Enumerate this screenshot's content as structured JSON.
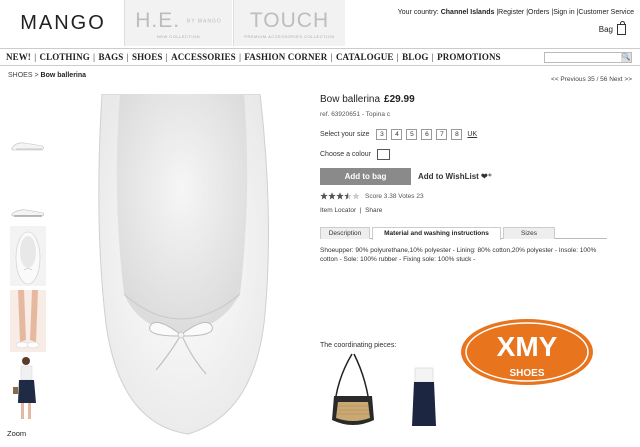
{
  "header": {
    "logo": "MANGO",
    "he_tab": {
      "title": "H.E.",
      "by": "BY MANGO",
      "sub": "NEW COLLECTION"
    },
    "touch_tab": {
      "title": "TOUCH",
      "sub": "PREMIUM ACCESSORIES COLLECTION"
    },
    "country_label": "Your country:",
    "country_value": "Channel Islands",
    "links": [
      "Register",
      "Orders",
      "Sign in",
      "Customer Service"
    ],
    "bag_label": "Bag"
  },
  "nav": {
    "items": [
      "NEW!",
      "CLOTHING",
      "BAGS",
      "SHOES",
      "ACCESSORIES",
      "FASHION CORNER",
      "CATALOGUE",
      "BLOG",
      "PROMOTIONS"
    ],
    "search_placeholder": "",
    "search_icon": "search-icon"
  },
  "breadcrumb": {
    "parent": "SHOES",
    "separator": ">",
    "current": "Bow ballerina"
  },
  "pager": {
    "prev": "<< Previous",
    "position": "35 / 56",
    "next": "Next >>"
  },
  "zoom_label": "Zoom",
  "product": {
    "name": "Bow ballerina",
    "price": "£29.99",
    "ref": "ref. 63920651 - Topina c",
    "size_label": "Select your size",
    "sizes": [
      "3",
      "4",
      "5",
      "6",
      "7",
      "8"
    ],
    "size_unit": "UK",
    "colour_label": "Choose a colour",
    "add_to_bag": "Add to bag",
    "wishlist": "Add to WishList",
    "rating": {
      "stars": 3.5,
      "max": 5,
      "score_label": "Score 3.38",
      "votes_label": "Votes",
      "votes": "23"
    },
    "item_locator": "Item Locator",
    "share": "Share",
    "tabs": [
      "Description",
      "Material and washing instructions",
      "Sizes"
    ],
    "active_tab": "Material and washing instructions",
    "composition": "Shoeupper: 90% polyurethane,10% polyester - Lining: 80% cotton,20% polyester - Insole: 100% cotton - Sole: 100% rubber - Fixing sole: 100% stuck -",
    "coordinating_label": "The coordinating pieces:"
  },
  "watermark": {
    "top": "XMY",
    "bottom": "SHOES"
  },
  "colors": {
    "add_bag_bg": "#8a8a8a",
    "watermark": "#e8741e"
  }
}
